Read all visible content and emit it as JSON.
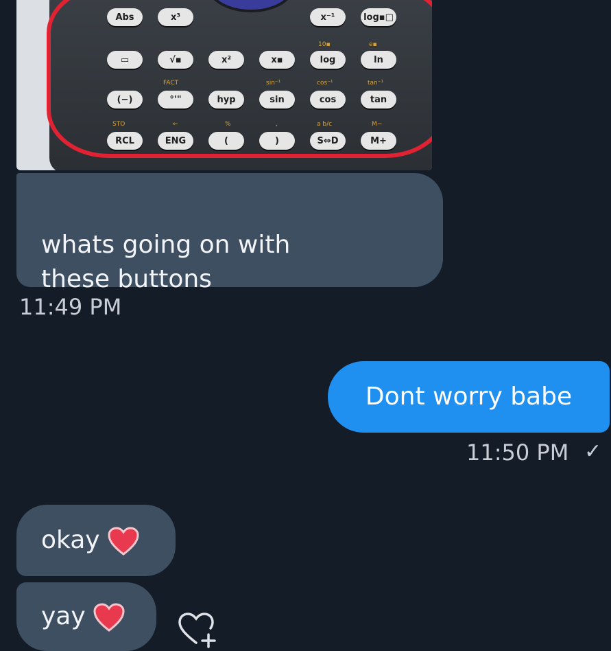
{
  "attachment": {
    "keys": [
      {
        "label": "Abs",
        "sub": ""
      },
      {
        "label": "x³",
        "sub": ""
      },
      {
        "label": "x⁻¹",
        "sub": ""
      },
      {
        "label": "log▪□",
        "sub": ""
      },
      {
        "label": "▭",
        "sub": ""
      },
      {
        "label": "√▪",
        "sub": ""
      },
      {
        "label": "x²",
        "sub": ""
      },
      {
        "label": "x▪",
        "sub": ""
      },
      {
        "label": "log",
        "sub": "10▪"
      },
      {
        "label": "ln",
        "sub": "e▪"
      },
      {
        "label": "(−)",
        "sub": ""
      },
      {
        "label": "°'\"",
        "sub": "FACT"
      },
      {
        "label": "hyp",
        "sub": ""
      },
      {
        "label": "sin",
        "sub": "sin⁻¹"
      },
      {
        "label": "cos",
        "sub": "cos⁻¹"
      },
      {
        "label": "tan",
        "sub": "tan⁻¹"
      },
      {
        "label": "RCL",
        "sub": "STO"
      },
      {
        "label": "ENG",
        "sub": "←"
      },
      {
        "label": "(",
        "sub": "%"
      },
      {
        "label": ")",
        "sub": ","
      },
      {
        "label": "S⇔D",
        "sub": "a b/c"
      },
      {
        "label": "M+",
        "sub": "M−"
      }
    ]
  },
  "messages": [
    {
      "text": "whats going on with\nthese buttons",
      "time": "11:49 PM"
    },
    {
      "text": "Dont worry babe",
      "time": "11:50 PM",
      "status": "✓"
    },
    {
      "text": "okay",
      "emoji": "heart"
    },
    {
      "text": "yay",
      "emoji": "heart"
    }
  ],
  "colors": {
    "background": "#141c27",
    "incoming_bubble": "#3f4f62",
    "outgoing_bubble": "#1f8ff0",
    "circle_annotation": "#e02233"
  }
}
